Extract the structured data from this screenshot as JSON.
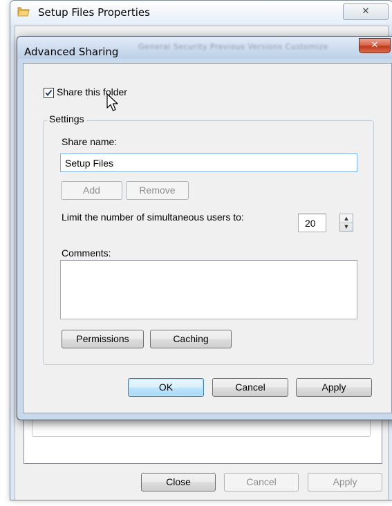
{
  "background_window": {
    "title": "Setup Files Properties",
    "close_label": "✕",
    "buttons": {
      "close": "Close",
      "cancel": "Cancel",
      "apply": "Apply"
    }
  },
  "dialog": {
    "title": "Advanced Sharing",
    "close_label": "✕",
    "ghost_tabs": "General    Security    Previous Versions    Customize",
    "share_checkbox": {
      "label": "Share this folder",
      "checked": true
    },
    "settings": {
      "legend": "Settings",
      "share_name_label": "Share name:",
      "share_name_value": "Setup Files",
      "add_label": "Add",
      "remove_label": "Remove",
      "limit_label": "Limit the number of simultaneous users to:",
      "limit_value": "20",
      "comments_label": "Comments:",
      "comments_value": "",
      "permissions_label": "Permissions",
      "caching_label": "Caching"
    },
    "buttons": {
      "ok": "OK",
      "cancel": "Cancel",
      "apply": "Apply"
    }
  },
  "icons": {
    "folder": "folder-icon",
    "checkmark": "checkmark-icon",
    "cursor": "mouse-pointer-icon",
    "spin_up": "spin-up-arrow-icon",
    "spin_down": "spin-down-arrow-icon"
  }
}
